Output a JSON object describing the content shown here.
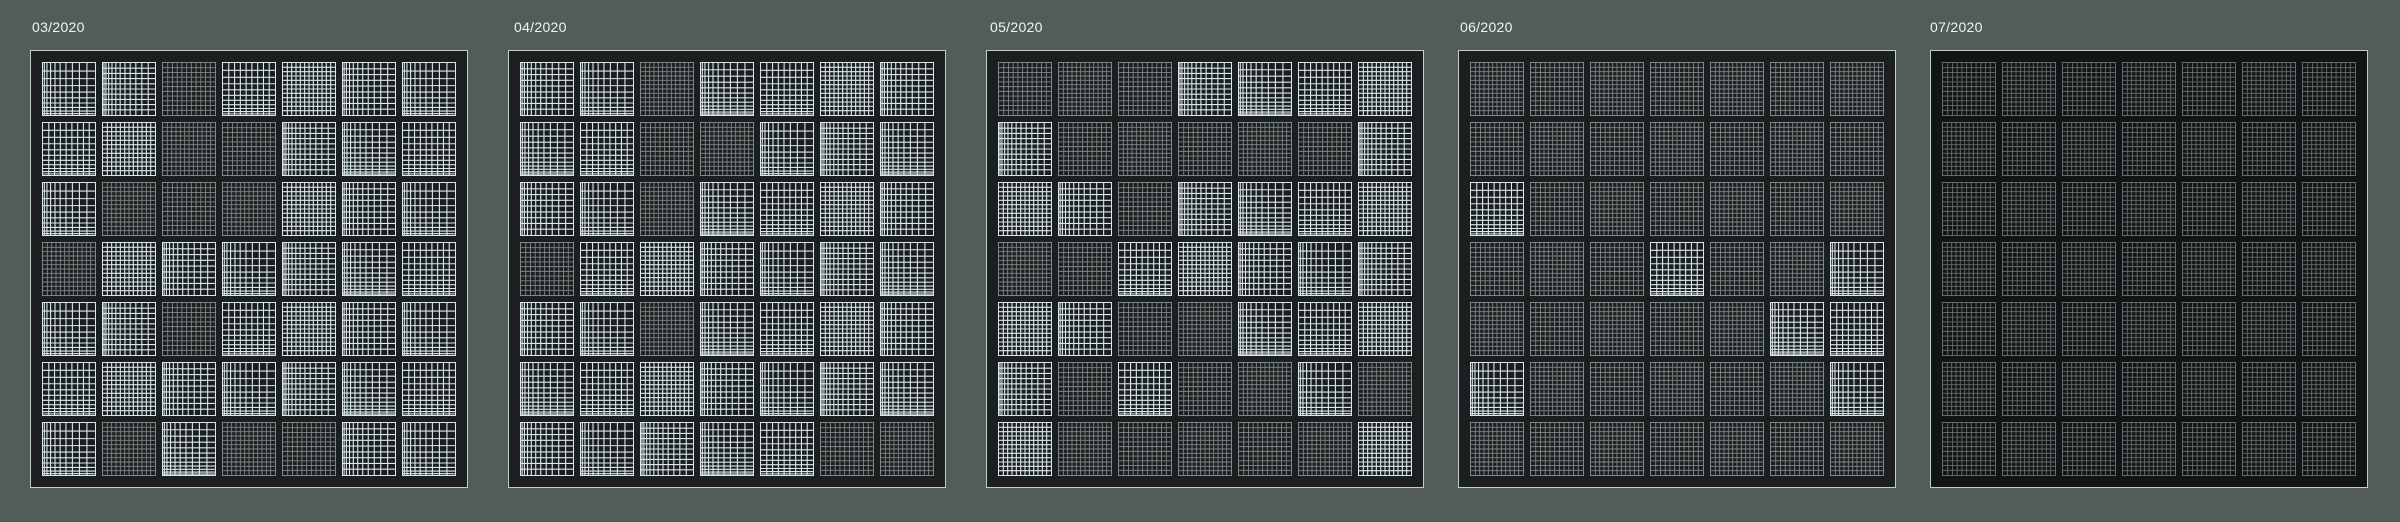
{
  "panels": [
    {
      "label": "03/2020",
      "bright": [
        [
          1,
          1,
          0,
          1,
          1,
          1,
          1
        ],
        [
          1,
          1,
          0,
          0,
          1,
          1,
          1
        ],
        [
          1,
          0,
          0,
          0,
          1,
          1,
          1
        ],
        [
          0,
          1,
          1,
          1,
          1,
          1,
          1
        ],
        [
          1,
          1,
          0,
          1,
          1,
          1,
          1
        ],
        [
          1,
          1,
          1,
          1,
          1,
          1,
          1
        ],
        [
          1,
          0,
          1,
          0,
          0,
          1,
          1
        ]
      ]
    },
    {
      "label": "04/2020",
      "bright": [
        [
          1,
          1,
          0,
          1,
          1,
          1,
          1
        ],
        [
          1,
          1,
          0,
          0,
          1,
          1,
          1
        ],
        [
          1,
          1,
          0,
          1,
          1,
          1,
          1
        ],
        [
          0,
          1,
          1,
          1,
          1,
          1,
          1
        ],
        [
          1,
          1,
          0,
          1,
          1,
          1,
          1
        ],
        [
          1,
          1,
          1,
          1,
          1,
          1,
          1
        ],
        [
          1,
          1,
          1,
          1,
          1,
          0,
          0
        ]
      ]
    },
    {
      "label": "05/2020",
      "bright": [
        [
          0,
          0,
          0,
          1,
          1,
          1,
          1
        ],
        [
          1,
          0,
          0,
          0,
          0,
          0,
          1
        ],
        [
          1,
          1,
          0,
          1,
          1,
          1,
          1
        ],
        [
          0,
          0,
          1,
          1,
          1,
          1,
          1
        ],
        [
          1,
          1,
          0,
          0,
          1,
          1,
          1
        ],
        [
          1,
          0,
          1,
          0,
          0,
          1,
          0
        ],
        [
          1,
          0,
          0,
          0,
          0,
          0,
          1
        ]
      ]
    },
    {
      "label": "06/2020",
      "bright": [
        [
          0,
          0,
          0,
          0,
          0,
          0,
          0
        ],
        [
          0,
          0,
          0,
          0,
          0,
          0,
          0
        ],
        [
          1,
          0,
          0,
          0,
          0,
          0,
          0
        ],
        [
          0,
          0,
          0,
          1,
          0,
          0,
          1
        ],
        [
          0,
          0,
          0,
          0,
          0,
          1,
          1
        ],
        [
          1,
          0,
          0,
          0,
          0,
          0,
          1
        ],
        [
          0,
          0,
          0,
          0,
          0,
          0,
          0
        ]
      ]
    },
    {
      "label": "07/2020",
      "bright": [
        [
          0,
          0,
          0,
          0,
          0,
          0,
          0
        ],
        [
          0,
          0,
          0,
          0,
          0,
          0,
          0
        ],
        [
          0,
          0,
          0,
          0,
          0,
          0,
          0
        ],
        [
          0,
          0,
          0,
          0,
          0,
          0,
          0
        ],
        [
          0,
          0,
          0,
          0,
          0,
          0,
          0
        ],
        [
          0,
          0,
          0,
          0,
          0,
          0,
          0
        ],
        [
          0,
          0,
          0,
          0,
          0,
          0,
          0
        ]
      ]
    }
  ],
  "colors": {
    "page_background": "#525d5a",
    "panel_background": "#1b1f1f",
    "panel_last_background": "#121515",
    "panel_border": "#c4ccca",
    "bright_cell_line": "#dbe9ee",
    "dim_cell_line": "#8f9b9b",
    "faded_cell_line": "#737d7d",
    "label_text": "#f2f4f3"
  }
}
